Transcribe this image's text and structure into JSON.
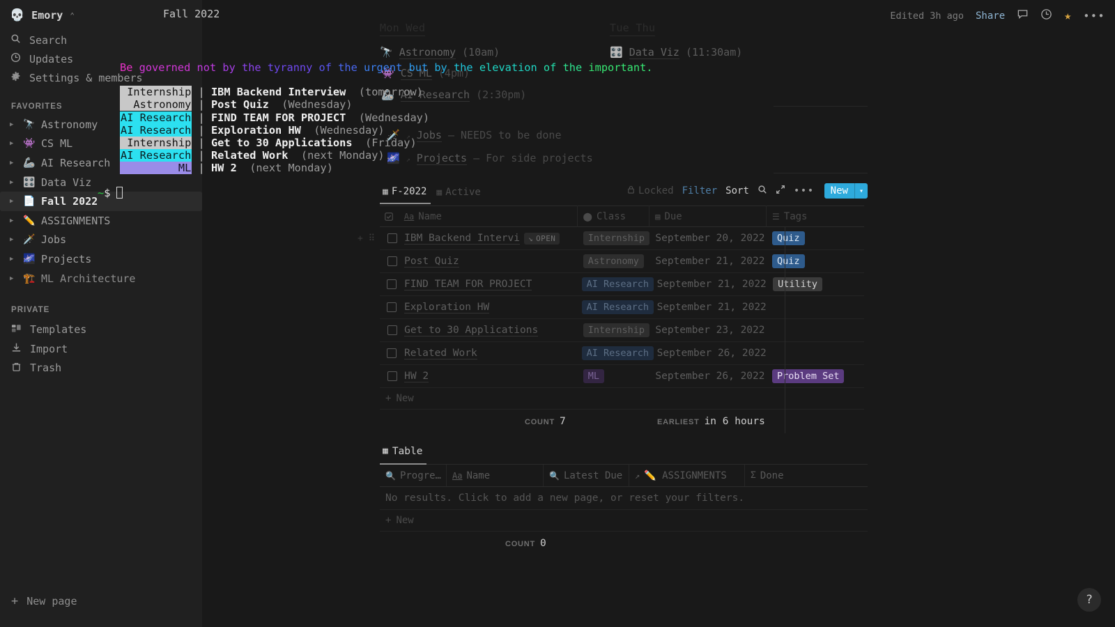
{
  "workspace": {
    "icon": "skull-icon",
    "name": "Emory",
    "caret": "⌃⌄"
  },
  "sidebar": {
    "nav": [
      {
        "icon": "search-icon",
        "label": "Search"
      },
      {
        "icon": "clock-icon",
        "label": "Updates"
      },
      {
        "icon": "gear-icon",
        "label": "Settings & members"
      }
    ],
    "favorites_label": "FAVORITES",
    "favorites": [
      {
        "emoji": "🔭",
        "label": "Astronomy"
      },
      {
        "emoji": "👾",
        "label": "CS ML"
      },
      {
        "emoji": "🦾",
        "label": "AI Research"
      },
      {
        "emoji": "🎛️",
        "label": "Data Viz"
      },
      {
        "emoji": "📄",
        "label": "Fall 2022"
      },
      {
        "emoji": "✏️",
        "label": "ASSIGNMENTS"
      },
      {
        "emoji": "🗡️",
        "label": "Jobs"
      },
      {
        "emoji": "🌌",
        "label": "Projects"
      },
      {
        "emoji": "🏗️",
        "label": "ML Architecture"
      }
    ],
    "private_label": "PRIVATE",
    "private": [
      {
        "icon": "templates-icon",
        "label": "Templates"
      },
      {
        "icon": "import-icon",
        "label": "Import"
      },
      {
        "icon": "trash-icon",
        "label": "Trash"
      }
    ],
    "new_page_label": "New page"
  },
  "topbar": {
    "breadcrumb": "Fall 2022",
    "edited": "Edited 3h ago",
    "share": "Share",
    "icons": [
      "comment-icon",
      "history-icon",
      "star-icon",
      "more-icon"
    ]
  },
  "page": {
    "calendar": [
      {
        "head": "Mon Wed",
        "entry": "Astronomy",
        "emoji": "🔭",
        "time": "(10am)"
      },
      {
        "head": "Tue Thu",
        "entry": "Data Viz",
        "emoji": "🎛️",
        "time": "(11:30am)"
      }
    ],
    "hidden_entries": [
      {
        "emoji": "👾",
        "label": "CS ML",
        "time": "(4pm)"
      },
      {
        "emoji": "🦾",
        "label": "AI Research",
        "time": "(2:30pm)"
      }
    ],
    "links": [
      {
        "emoji": "🗡️",
        "label": "Jobs",
        "note": "— NEEDS to be done"
      },
      {
        "emoji": "🌌",
        "label": "Projects",
        "note": "— For side projects"
      }
    ]
  },
  "db1": {
    "tabs": [
      {
        "icon": "table-icon",
        "label": "F-2022",
        "selected": true
      },
      {
        "icon": "table-icon",
        "label": "Active",
        "selected": false
      }
    ],
    "locked": "Locked",
    "filter": "Filter",
    "sort": "Sort",
    "search_icon": "search-icon",
    "expand_icon": "expand-icon",
    "more_icon": "more-icon",
    "new_label": "New",
    "new_chevron": "▾",
    "columns": [
      {
        "icon": "text-icon",
        "label": "Name"
      },
      {
        "icon": "select-icon",
        "label": "Class"
      },
      {
        "icon": "date-icon",
        "label": "Due"
      },
      {
        "icon": "multiselect-icon",
        "label": "Tags"
      }
    ],
    "rows": [
      {
        "name": "IBM Backend Intervi",
        "open_badge": "OPEN",
        "class": "Internship",
        "class_color": "gray",
        "due": "September 20, 2022",
        "tag": "Quiz",
        "tag_color": "blue"
      },
      {
        "name": "Post Quiz",
        "open_badge": "",
        "class": "Astronomy",
        "class_color": "gray",
        "due": "September 21, 2022",
        "tag": "Quiz",
        "tag_color": "blue"
      },
      {
        "name": "FIND TEAM FOR PROJECT",
        "open_badge": "",
        "class": "AI Research",
        "class_color": "navy",
        "due": "September 21, 2022",
        "tag": "Utility",
        "tag_color": "gray"
      },
      {
        "name": "Exploration HW",
        "open_badge": "",
        "class": "AI Research",
        "class_color": "navy",
        "due": "September 21, 2022",
        "tag": "",
        "tag_color": ""
      },
      {
        "name": "Get to 30 Applications",
        "open_badge": "",
        "class": "Internship",
        "class_color": "gray",
        "due": "September 23, 2022",
        "tag": "",
        "tag_color": ""
      },
      {
        "name": "Related Work",
        "open_badge": "",
        "class": "AI Research",
        "class_color": "navy",
        "due": "September 26, 2022",
        "tag": "",
        "tag_color": ""
      },
      {
        "name": "HW 2",
        "open_badge": "",
        "class": "ML",
        "class_color": "purple",
        "due": "September 26, 2022",
        "tag": "Problem Set",
        "tag_color": "purple"
      }
    ],
    "new_row_label": "New",
    "count_label": "COUNT",
    "count_value": "7",
    "earliest_label": "EARLIEST",
    "earliest_value": "in 6 hours"
  },
  "db2": {
    "tab": {
      "icon": "table-icon",
      "label": "Table"
    },
    "columns": [
      {
        "icon": "rollup-icon",
        "label": "Progre…"
      },
      {
        "icon": "text-icon",
        "label": "Name"
      },
      {
        "icon": "rollup-icon",
        "label": "Latest Due"
      },
      {
        "icon": "relation-icon",
        "label": "✏️ ASSIGNMENTS"
      },
      {
        "icon": "sigma-icon",
        "label": "Done"
      }
    ],
    "empty_message": "No results. Click to add a new page, or reset your filters.",
    "new_row_label": "New",
    "count_label": "COUNT",
    "count_value": "0"
  },
  "help_icon": "question-icon",
  "terminal": {
    "quote_words": [
      {
        "t": "Be",
        "c": "#e832c8"
      },
      {
        "t": "governed",
        "c": "#d236d8"
      },
      {
        "t": "not",
        "c": "#c03adf"
      },
      {
        "t": "by",
        "c": "#a63ee6"
      },
      {
        "t": "the",
        "c": "#8b43ec"
      },
      {
        "t": "tyranny",
        "c": "#6f49f0"
      },
      {
        "t": "of",
        "c": "#5a55f2"
      },
      {
        "t": "the",
        "c": "#4a68f3"
      },
      {
        "t": "urgent",
        "c": "#3b80f2"
      },
      {
        "t": "but",
        "c": "#2f9aee"
      },
      {
        "t": "by",
        "c": "#25b2e6"
      },
      {
        "t": "the",
        "c": "#1fc6da"
      },
      {
        "t": "elevation",
        "c": "#1fd6c5"
      },
      {
        "t": "of",
        "c": "#24dfac"
      },
      {
        "t": "the",
        "c": "#2ee48f"
      },
      {
        "t": "important.",
        "c": "#37e873"
      }
    ],
    "tasks": [
      {
        "class": "Internship",
        "title": "IBM Backend Interview",
        "when": "(tomorrow)",
        "style": "gray"
      },
      {
        "class": "Astronomy",
        "title": "Post Quiz",
        "when": "(Wednesday)",
        "style": "gray"
      },
      {
        "class": "AI Research",
        "title": "FIND TEAM FOR PROJECT",
        "when": "(Wednesday)",
        "style": "cyan"
      },
      {
        "class": "AI Research",
        "title": "Exploration HW",
        "when": "(Wednesday)",
        "style": "cyan"
      },
      {
        "class": "Internship",
        "title": "Get to 30 Applications",
        "when": "(Friday)",
        "style": "gray"
      },
      {
        "class": "AI Research",
        "title": "Related Work",
        "when": "(next Monday)",
        "style": "cyan"
      },
      {
        "class": "ML",
        "title": "HW 2",
        "when": "(next Monday)",
        "style": "lavender"
      }
    ],
    "prompt_tilde": "~",
    "prompt_dollar": "$"
  }
}
